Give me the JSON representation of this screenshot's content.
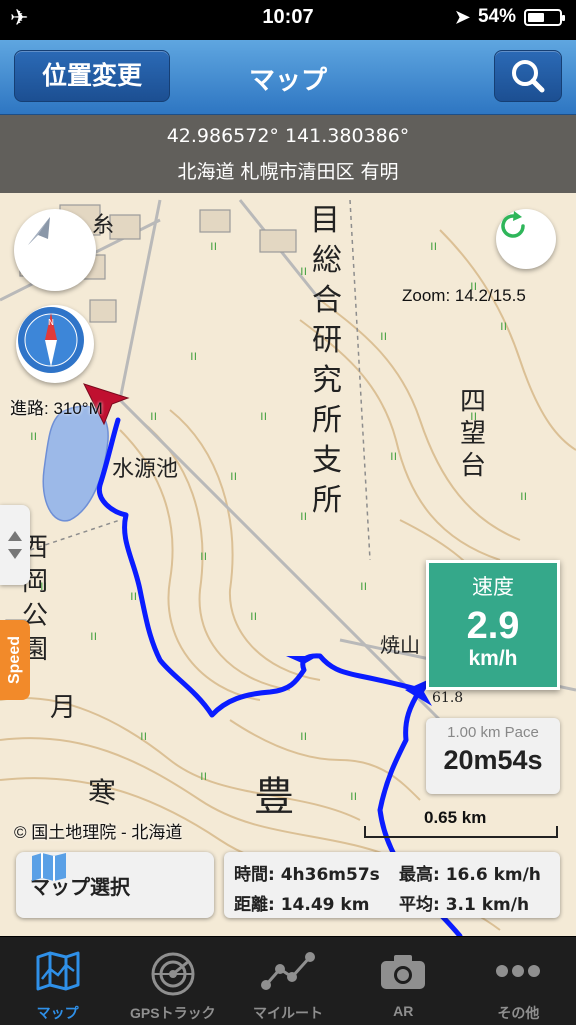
{
  "status_bar": {
    "time": "10:07",
    "battery_level": "54%",
    "battery_fraction": 0.54
  },
  "nav": {
    "left_button": "位置変更",
    "title": "マップ",
    "right_icon": "search-icon"
  },
  "location": {
    "coords": "42.986572° 141.380386°",
    "address": "北海道 札幌市清田区 有明"
  },
  "map": {
    "heading": "進路: 310°M",
    "zoom": "Zoom: 14.2/15.5",
    "copyright": "© 国土地理院 - 北海道",
    "scale": "0.65 km",
    "speed_tab": "Speed",
    "labels": {
      "kanji_vertical": "総合研究所支所",
      "kanji_right": "四望台",
      "pond": "水源池",
      "left_vertical": "西岡公園",
      "tsuki": "月",
      "kan": "寒",
      "toyo": "豊",
      "yaki": "焼山",
      "elev": "61.8"
    },
    "top_left_chars": "糸"
  },
  "speed_panel": {
    "label": "速度",
    "value": "2.9",
    "unit": "km/h",
    "color": "#35a88a"
  },
  "pace_panel": {
    "label": "1.00 km Pace",
    "value": "20m54s"
  },
  "map_select": {
    "label": "マップ選択",
    "icon": "map-icon"
  },
  "stats": {
    "time": "時間: 4h36m57s",
    "max": "最高: 16.6 km/h",
    "distance": "距離: 14.49 km",
    "avg": "平均: 3.1 km/h"
  },
  "tabs": [
    {
      "label": "マップ",
      "icon": "map-icon",
      "active": true
    },
    {
      "label": "GPSトラック",
      "icon": "radar-icon",
      "active": false
    },
    {
      "label": "マイルート",
      "icon": "route-icon",
      "active": false
    },
    {
      "label": "AR",
      "icon": "camera-icon",
      "active": false
    },
    {
      "label": "その他",
      "icon": "more-icon",
      "active": false
    }
  ],
  "colors": {
    "accent": "#2f90e8",
    "track": "#0a1cff",
    "nav": "#3a86d0"
  }
}
